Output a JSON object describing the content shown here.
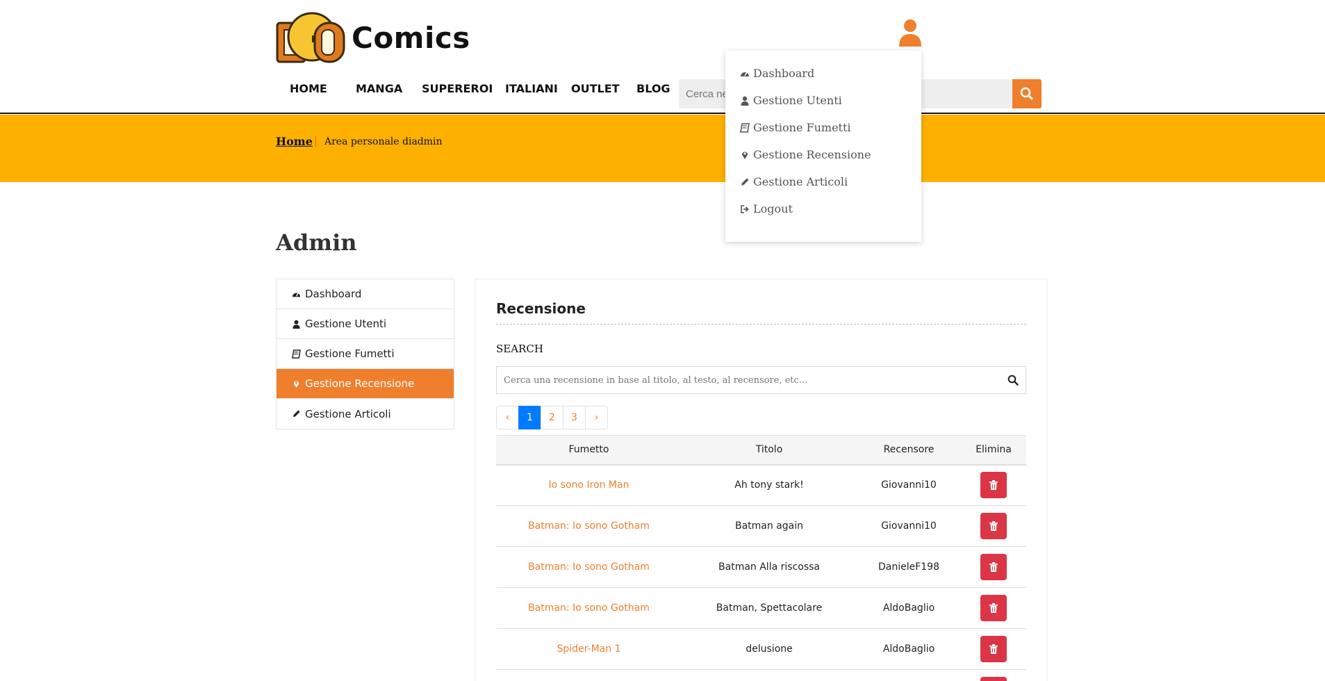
{
  "header": {
    "logo_text": "Comics",
    "logo_mark": "DGD",
    "nav": [
      "HOME",
      "MANGA",
      "SUPEREROI",
      "ITALIANI",
      "OUTLET",
      "BLOG"
    ],
    "search_placeholder": "Cerca nel"
  },
  "breadcrumb": {
    "home": "Home",
    "current": "Area personale diadmin"
  },
  "dropdown": {
    "items": [
      {
        "label": "Dashboard",
        "icon": "tachometer-icon"
      },
      {
        "label": "Gestione Utenti",
        "icon": "user-icon"
      },
      {
        "label": "Gestione Fumetti",
        "icon": "book-icon"
      },
      {
        "label": "Gestione Recensione",
        "icon": "map-marker-icon"
      },
      {
        "label": "Gestione Articoli",
        "icon": "pencil-icon"
      },
      {
        "label": "Logout",
        "icon": "sign-out-icon"
      }
    ]
  },
  "page": {
    "title": "Admin"
  },
  "sidebar": {
    "items": [
      {
        "label": "Dashboard",
        "icon": "tachometer-icon"
      },
      {
        "label": "Gestione Utenti",
        "icon": "user-icon"
      },
      {
        "label": "Gestione Fumetti",
        "icon": "book-icon"
      },
      {
        "label": "Gestione Recensione",
        "icon": "map-marker-icon",
        "active": true
      },
      {
        "label": "Gestione Articoli",
        "icon": "pencil-icon"
      }
    ]
  },
  "panel": {
    "title": "Recensione",
    "search_label": "SEARCH",
    "search_placeholder": "Cerca una recensione in base al titolo, al testo, al recensore, etc...",
    "pagination": {
      "prev": "‹",
      "pages": [
        "1",
        "2",
        "3"
      ],
      "next": "›",
      "current": "1"
    },
    "table": {
      "headers": [
        "Fumetto",
        "Titolo",
        "Recensore",
        "Elimina"
      ],
      "rows": [
        {
          "fumetto": "Io sono Iron Man",
          "titolo": "Ah tony stark!",
          "recensore": "Giovanni10"
        },
        {
          "fumetto": "Batman: Io sono Gotham",
          "titolo": "Batman again",
          "recensore": "Giovanni10"
        },
        {
          "fumetto": "Batman: Io sono Gotham",
          "titolo": "Batman Alla riscossa",
          "recensore": "DanieleF198"
        },
        {
          "fumetto": "Batman: Io sono Gotham",
          "titolo": "Batman, Spettacolare",
          "recensore": "AldoBaglio"
        },
        {
          "fumetto": "Spider-Man 1",
          "titolo": "delusione",
          "recensore": "AldoBaglio"
        },
        {
          "fumetto": "",
          "titolo": "",
          "recensore": ""
        }
      ]
    }
  },
  "colors": {
    "accent": "#ef7f2d",
    "band": "#fdb000",
    "danger": "#dc3545",
    "pager_active": "#007bff"
  }
}
